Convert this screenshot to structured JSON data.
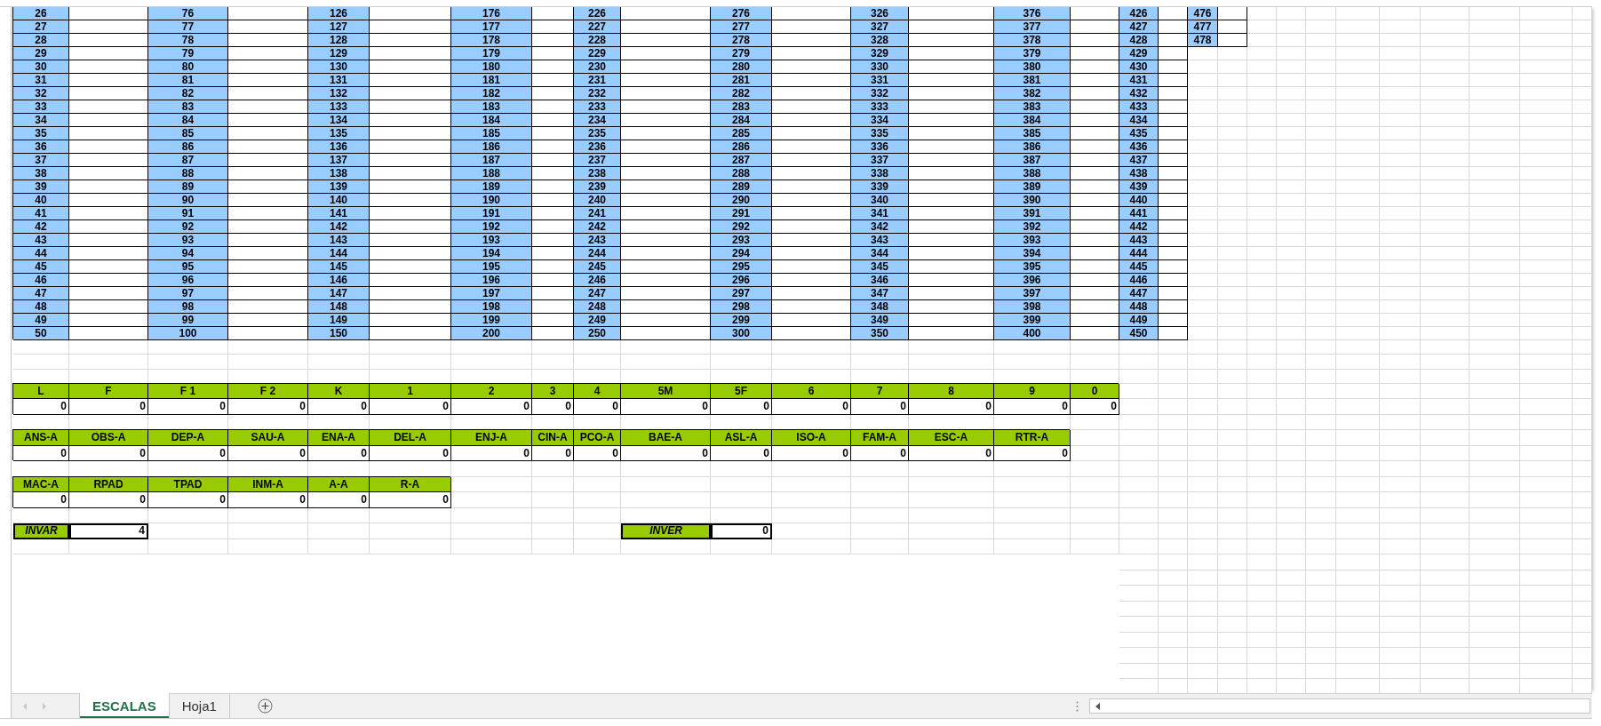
{
  "number_columns": [
    {
      "numbers": [
        "26",
        "27",
        "28",
        "29",
        "30",
        "31",
        "32",
        "33",
        "34",
        "35",
        "36",
        "37",
        "38",
        "39",
        "40",
        "41",
        "42",
        "43",
        "44",
        "45",
        "46",
        "47",
        "48",
        "49",
        "50"
      ]
    },
    {
      "numbers": [
        "76",
        "77",
        "78",
        "79",
        "80",
        "81",
        "82",
        "83",
        "84",
        "85",
        "86",
        "87",
        "88",
        "89",
        "90",
        "91",
        "92",
        "93",
        "94",
        "95",
        "96",
        "97",
        "98",
        "99",
        "100"
      ]
    },
    {
      "numbers": [
        "126",
        "127",
        "128",
        "129",
        "130",
        "131",
        "132",
        "133",
        "134",
        "135",
        "136",
        "137",
        "138",
        "139",
        "140",
        "141",
        "142",
        "143",
        "144",
        "145",
        "146",
        "147",
        "148",
        "149",
        "150"
      ]
    },
    {
      "numbers": [
        "176",
        "177",
        "178",
        "179",
        "180",
        "181",
        "182",
        "183",
        "184",
        "185",
        "186",
        "187",
        "188",
        "189",
        "190",
        "191",
        "192",
        "193",
        "194",
        "195",
        "196",
        "197",
        "198",
        "199",
        "200"
      ]
    },
    {
      "numbers": [
        "226",
        "227",
        "228",
        "229",
        "230",
        "231",
        "232",
        "233",
        "234",
        "235",
        "236",
        "237",
        "238",
        "239",
        "240",
        "241",
        "242",
        "243",
        "244",
        "245",
        "246",
        "247",
        "248",
        "249",
        "250"
      ]
    },
    {
      "numbers": [
        "276",
        "277",
        "278",
        "279",
        "280",
        "281",
        "282",
        "283",
        "284",
        "285",
        "286",
        "287",
        "288",
        "289",
        "290",
        "291",
        "292",
        "293",
        "294",
        "295",
        "296",
        "297",
        "298",
        "299",
        "300"
      ]
    },
    {
      "numbers": [
        "326",
        "327",
        "328",
        "329",
        "330",
        "331",
        "332",
        "333",
        "334",
        "335",
        "336",
        "337",
        "338",
        "339",
        "340",
        "341",
        "342",
        "343",
        "344",
        "345",
        "346",
        "347",
        "348",
        "349",
        "350"
      ]
    },
    {
      "numbers": [
        "376",
        "377",
        "378",
        "379",
        "380",
        "381",
        "382",
        "383",
        "384",
        "385",
        "386",
        "387",
        "388",
        "389",
        "390",
        "391",
        "392",
        "393",
        "394",
        "395",
        "396",
        "397",
        "398",
        "399",
        "400"
      ]
    },
    {
      "numbers": [
        "426",
        "427",
        "428",
        "429",
        "430",
        "431",
        "432",
        "433",
        "434",
        "435",
        "436",
        "437",
        "438",
        "439",
        "440",
        "441",
        "442",
        "443",
        "444",
        "445",
        "446",
        "447",
        "448",
        "449",
        "450"
      ]
    },
    {
      "numbers": [
        "476",
        "477",
        "478"
      ]
    }
  ],
  "scale_tables": [
    {
      "cells": [
        {
          "header": "L",
          "value": "0"
        },
        {
          "header": "F",
          "value": "0"
        },
        {
          "header": "F 1",
          "value": "0"
        },
        {
          "header": "F 2",
          "value": "0"
        },
        {
          "header": "K",
          "value": "0"
        },
        {
          "header": "1",
          "value": "0"
        },
        {
          "header": "2",
          "value": "0"
        },
        {
          "header": "3",
          "value": "0"
        },
        {
          "header": "4",
          "value": "0"
        },
        {
          "header": "5M",
          "value": "0"
        },
        {
          "header": "5F",
          "value": "0"
        },
        {
          "header": "6",
          "value": "0"
        },
        {
          "header": "7",
          "value": "0"
        },
        {
          "header": "8",
          "value": "0"
        },
        {
          "header": "9",
          "value": "0"
        },
        {
          "header": "0",
          "value": "0"
        }
      ]
    },
    {
      "cells": [
        {
          "header": "ANS-A",
          "value": "0"
        },
        {
          "header": "OBS-A",
          "value": "0"
        },
        {
          "header": "DEP-A",
          "value": "0"
        },
        {
          "header": "SAU-A",
          "value": "0"
        },
        {
          "header": "ENA-A",
          "value": "0"
        },
        {
          "header": "DEL-A",
          "value": "0"
        },
        {
          "header": "ENJ-A",
          "value": "0"
        },
        {
          "header": "CIN-A",
          "value": "0"
        },
        {
          "header": "PCO-A",
          "value": "0"
        },
        {
          "header": "BAE-A",
          "value": "0"
        },
        {
          "header": "ASL-A",
          "value": "0"
        },
        {
          "header": "ISO-A",
          "value": "0"
        },
        {
          "header": "FAM-A",
          "value": "0"
        },
        {
          "header": "ESC-A",
          "value": "0"
        },
        {
          "header": "RTR-A",
          "value": "0"
        }
      ]
    },
    {
      "cells": [
        {
          "header": "MAC-A",
          "value": "0"
        },
        {
          "header": "RPAD",
          "value": "0"
        },
        {
          "header": "TPAD",
          "value": "0"
        },
        {
          "header": "INM-A",
          "value": "0"
        },
        {
          "header": "A-A",
          "value": "0"
        },
        {
          "header": "R-A",
          "value": "0"
        }
      ]
    }
  ],
  "inconsistency_scores": [
    {
      "label": "INVAR",
      "value": "4"
    },
    {
      "label": "INVER",
      "value": "0"
    }
  ],
  "sheet_tabs": [
    {
      "label": "ESCALAS",
      "selected": true
    },
    {
      "label": "Hoja1",
      "selected": false
    }
  ]
}
